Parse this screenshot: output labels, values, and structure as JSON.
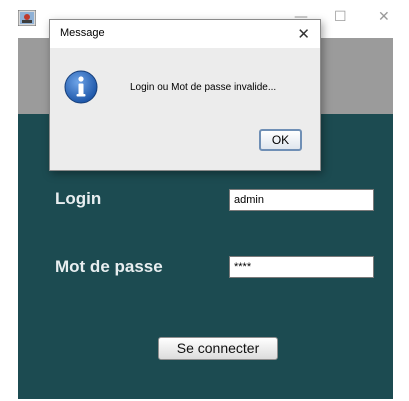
{
  "window": {
    "minimize_glyph": "—",
    "maximize_glyph": "☐",
    "close_glyph": "✕"
  },
  "form": {
    "login_label": "Login",
    "login_value": "admin",
    "password_label": "Mot de passe",
    "password_value": "****",
    "connect_label": "Se connecter"
  },
  "dialog": {
    "title": "Message",
    "close_glyph": "✕",
    "message": "Login ou Mot de passe invalide...",
    "ok_label": "OK",
    "icon": "info-icon"
  },
  "colors": {
    "panel": "#1c4b51",
    "band": "#9b9b9b",
    "info_icon": "#2a6bc4"
  }
}
